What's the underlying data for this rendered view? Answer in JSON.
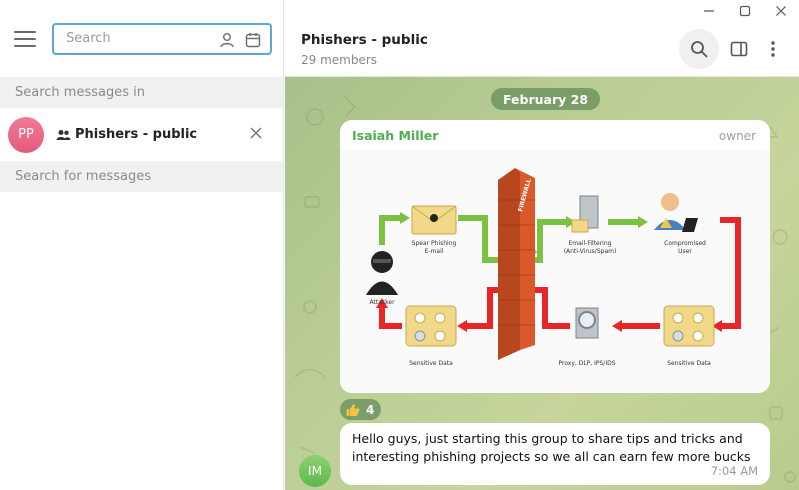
{
  "window": {
    "minimize": "–",
    "maximize": "□",
    "close": "✕"
  },
  "left": {
    "search": {
      "placeholder": "Search",
      "value": ""
    },
    "search_in_label": "Search messages in",
    "chat": {
      "avatar_initials": "PP",
      "name": "Phishers - public"
    },
    "search_for_label": "Search for messages"
  },
  "header": {
    "title": "Phishers - public",
    "subtitle": "29 members"
  },
  "chat": {
    "date": "February 28",
    "message1": {
      "sender": "Isaiah Miller",
      "role": "owner",
      "diagram": {
        "attacker": "Attacker",
        "spear_1": "Spear Phishing",
        "spear_2": "E-mail",
        "firewall": "FIREWALL",
        "filter_1": "Email-Filtering",
        "filter_2": "(Anti-Virus/Spam)",
        "comp_1": "Compromised",
        "comp_2": "User",
        "sens_left": "Sensitive Data",
        "proxy": "Proxy, DLP, IPS/IDS",
        "sens_right": "Sensitive Data"
      }
    },
    "reaction": {
      "emoji_name": "thumbs-up-icon",
      "count": "4"
    },
    "message2": {
      "avatar_initials": "IM",
      "text_line1": "Hello guys, just starting this group to share tips and tricks and",
      "text_line2": "interesting phishing projects so we all can earn few more bucks",
      "time": "7:04 AM"
    }
  },
  "colors": {
    "accent": "#5ea6d6",
    "sender": "#4fae4e",
    "date_pill": "#709460",
    "avatar_pp": "#e55a7b",
    "avatar_im": "#5fb84d"
  }
}
